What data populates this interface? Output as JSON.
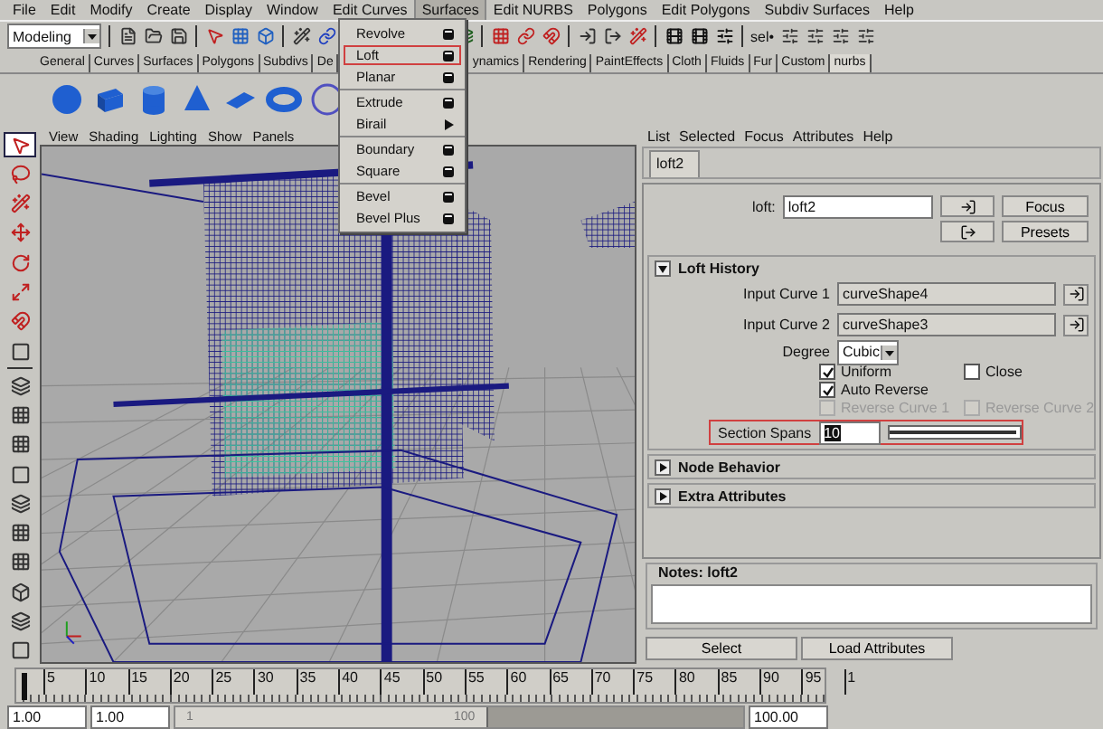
{
  "menubar": [
    {
      "label": "File",
      "selected": false
    },
    {
      "label": "Edit",
      "selected": false
    },
    {
      "label": "Modify",
      "selected": false
    },
    {
      "label": "Create",
      "selected": false
    },
    {
      "label": "Display",
      "selected": false
    },
    {
      "label": "Window",
      "selected": false
    },
    {
      "label": "Edit Curves",
      "selected": false
    },
    {
      "label": "Surfaces",
      "selected": true
    },
    {
      "label": "Edit NURBS",
      "selected": false
    },
    {
      "label": "Polygons",
      "selected": false
    },
    {
      "label": "Edit Polygons",
      "selected": false
    },
    {
      "label": "Subdiv Surfaces",
      "selected": false
    },
    {
      "label": "Help",
      "selected": false
    }
  ],
  "status_line": {
    "mode": "Modeling",
    "selection_label": "sel•"
  },
  "shelf_tabs": [
    {
      "label": "General",
      "selected": false
    },
    {
      "label": "Curves",
      "selected": false
    },
    {
      "label": "Surfaces",
      "selected": false
    },
    {
      "label": "Polygons",
      "selected": false
    },
    {
      "label": "Subdivs",
      "selected": false
    },
    {
      "label": "De",
      "selected": false
    },
    {
      "label": "ynamics",
      "selected": false
    },
    {
      "label": "Rendering",
      "selected": false
    },
    {
      "label": "PaintEffects",
      "selected": false
    },
    {
      "label": "Cloth",
      "selected": false
    },
    {
      "label": "Fluids",
      "selected": false
    },
    {
      "label": "Fur",
      "selected": false
    },
    {
      "label": "Custom",
      "selected": false
    },
    {
      "label": "nurbs",
      "selected": true
    }
  ],
  "surfaces_menu": {
    "groups": [
      [
        {
          "label": "Revolve",
          "kind": "option",
          "selected": false
        },
        {
          "label": "Loft",
          "kind": "option",
          "selected": true
        },
        {
          "label": "Planar",
          "kind": "option",
          "selected": false
        }
      ],
      [
        {
          "label": "Extrude",
          "kind": "option",
          "selected": false
        },
        {
          "label": "Birail",
          "kind": "submenu",
          "selected": false
        }
      ],
      [
        {
          "label": "Boundary",
          "kind": "option",
          "selected": false
        },
        {
          "label": "Square",
          "kind": "option",
          "selected": false
        }
      ],
      [
        {
          "label": "Bevel",
          "kind": "option",
          "selected": false
        },
        {
          "label": "Bevel Plus",
          "kind": "option",
          "selected": false
        }
      ]
    ]
  },
  "viewport": {
    "menu": [
      "View",
      "Shading",
      "Lighting",
      "Show",
      "Panels"
    ]
  },
  "attribute_editor": {
    "menu": [
      "List",
      "Selected",
      "Focus",
      "Attributes",
      "Help"
    ],
    "tab": "loft2",
    "node_label": "loft:",
    "node_name": "loft2",
    "buttons": [
      "Focus",
      "Presets"
    ],
    "sections": [
      {
        "title": "Loft History",
        "expanded": true
      },
      {
        "title": "Node Behavior",
        "expanded": false
      },
      {
        "title": "Extra Attributes",
        "expanded": false
      }
    ],
    "input_curves": [
      {
        "label": "Input Curve 1",
        "value": "curveShape4"
      },
      {
        "label": "Input Curve 2",
        "value": "curveShape3"
      }
    ],
    "degree": {
      "label": "Degree",
      "value": "Cubic"
    },
    "checkboxes": [
      {
        "label": "Uniform",
        "checked": true,
        "disabled": false
      },
      {
        "label": "Close",
        "checked": false,
        "disabled": false
      },
      {
        "label": "Auto Reverse",
        "checked": true,
        "disabled": false
      },
      {
        "label": "Reverse Curve 1",
        "checked": false,
        "disabled": true
      },
      {
        "label": "Reverse Curve 2",
        "checked": false,
        "disabled": true
      }
    ],
    "section_spans": {
      "label": "Section Spans",
      "value": "10",
      "highlighted": true,
      "level": 0.98
    },
    "notes_title": "Notes: loft2",
    "footer_buttons": [
      "Select",
      "Load Attributes"
    ]
  },
  "timeline": {
    "level": 0,
    "range_slider": {
      "level": 0.55
    },
    "ticks": [
      "5",
      "10",
      "15",
      "20",
      "25",
      "30",
      "35",
      "40",
      "45",
      "50",
      "55",
      "60",
      "65",
      "70",
      "75",
      "80",
      "85",
      "90",
      "95",
      "1"
    ],
    "start_time": "1.00",
    "playback_start": "1.00",
    "range_start": "1",
    "range_end": "100",
    "playback_end": "100.00"
  }
}
